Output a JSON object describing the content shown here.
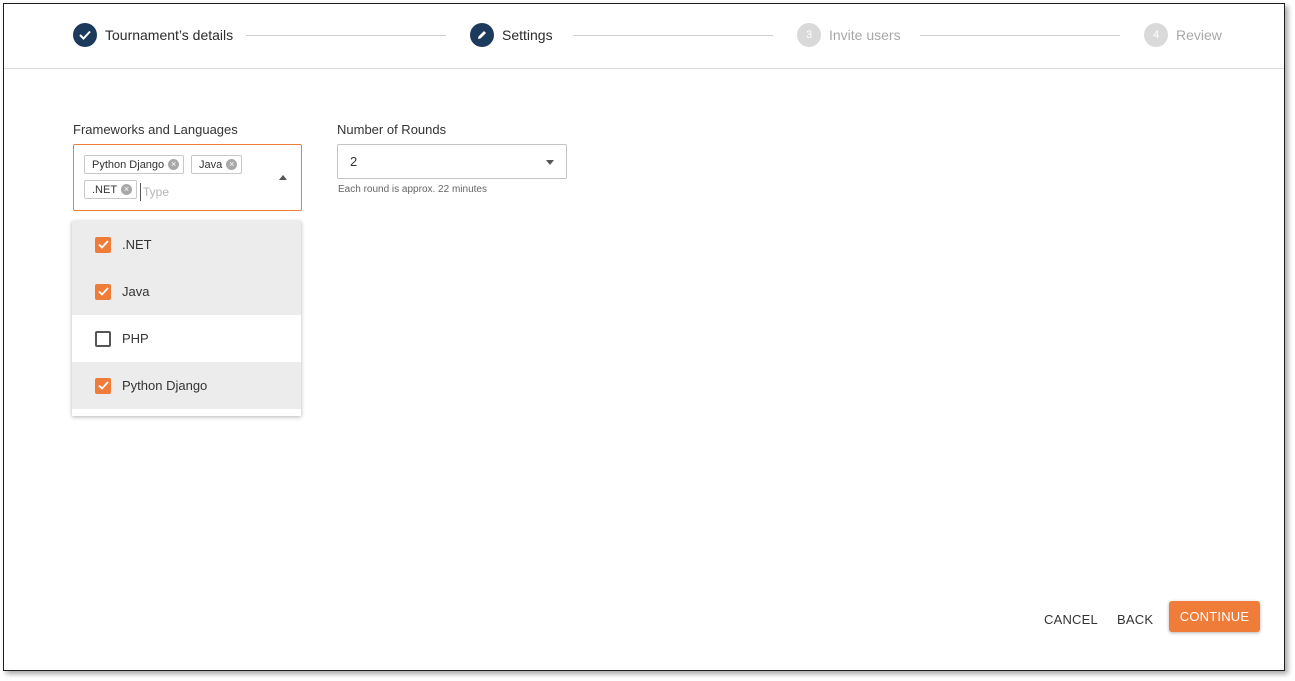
{
  "stepper": {
    "steps": [
      {
        "label": "Tournament’s details",
        "state": "complete",
        "marker": "check-icon"
      },
      {
        "label": "Settings",
        "state": "current",
        "marker": "pencil-icon"
      },
      {
        "label": "Invite users",
        "state": "inactive",
        "number": "3"
      },
      {
        "label": "Review",
        "state": "inactive",
        "number": "4"
      }
    ]
  },
  "frameworks": {
    "label": "Frameworks and Languages",
    "selected_chips": [
      "Python Django",
      "Java",
      ".NET"
    ],
    "input_placeholder": "Type",
    "options": [
      {
        "label": ".NET",
        "checked": true
      },
      {
        "label": "Java",
        "checked": true
      },
      {
        "label": "PHP",
        "checked": false
      },
      {
        "label": "Python Django",
        "checked": true
      }
    ]
  },
  "rounds": {
    "label": "Number of Rounds",
    "value": "2",
    "helper": "Each round is approx. 22 minutes"
  },
  "actions": {
    "cancel": "CANCEL",
    "back": "BACK",
    "continue": "CONTINUE"
  },
  "colors": {
    "accent": "#f07c3a",
    "step_complete": "#1b3a5c",
    "step_inactive": "#d9d9d9"
  }
}
